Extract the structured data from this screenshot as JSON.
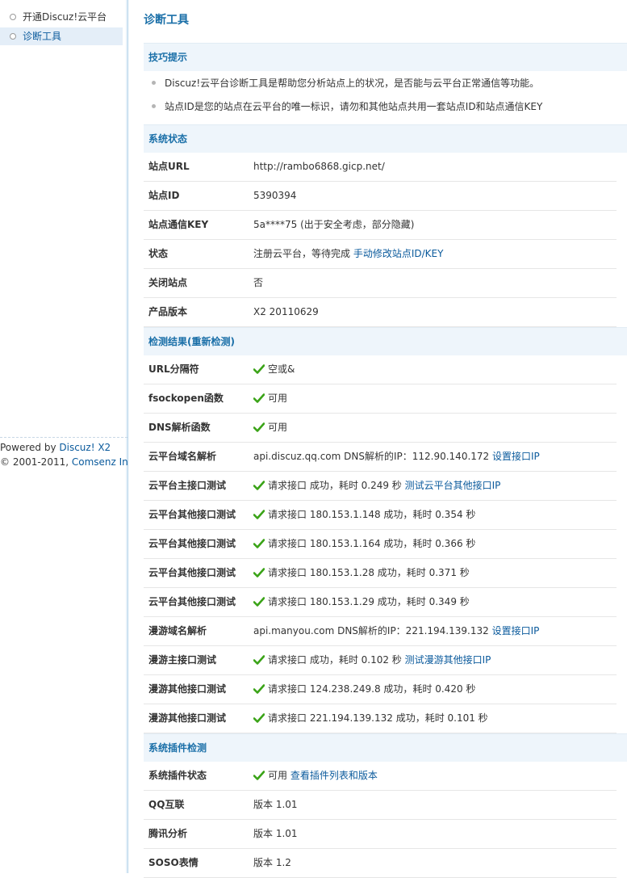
{
  "sidebar": {
    "items": [
      {
        "label": "开通Discuz!云平台"
      },
      {
        "label": "诊断工具"
      }
    ],
    "powered_prefix": "Powered by ",
    "powered_link": "Discuz! X2",
    "copyright_prefix": "© 2001-2011, ",
    "copyright_link": "Comsenz Inc."
  },
  "page_title": "诊断工具",
  "tips": {
    "header": "技巧提示",
    "items": [
      "Discuz!云平台诊断工具是帮助您分析站点上的状况，是否能与云平台正常通信等功能。",
      "站点ID是您的站点在云平台的唯一标识，请勿和其他站点共用一套站点ID和站点通信KEY"
    ]
  },
  "system_status": {
    "header": "系统状态",
    "rows": [
      {
        "label": "站点URL",
        "value": "http://rambo6868.gicp.net/"
      },
      {
        "label": "站点ID",
        "value": "5390394"
      },
      {
        "label": "站点通信KEY",
        "value": "5a****75 (出于安全考虑，部分隐藏)"
      },
      {
        "label": "状态",
        "value": "注册云平台，等待完成 ",
        "link": "手动修改站点ID/KEY"
      },
      {
        "label": "关闭站点",
        "value": "否"
      },
      {
        "label": "产品版本",
        "value": "X2 20110629"
      }
    ]
  },
  "detection": {
    "header": "检测结果(重新检测)",
    "rows": [
      {
        "label": "URL分隔符",
        "check": true,
        "value": "空或&"
      },
      {
        "label": "fsockopen函数",
        "check": true,
        "value": "可用"
      },
      {
        "label": "DNS解析函数",
        "check": true,
        "value": "可用"
      },
      {
        "label": "云平台域名解析",
        "check": false,
        "value": "api.discuz.qq.com DNS解析的IP：112.90.140.172 ",
        "link": "设置接口IP"
      },
      {
        "label": "云平台主接口测试",
        "check": true,
        "value": "请求接口 成功，耗时 0.249 秒 ",
        "link": "测试云平台其他接口IP"
      },
      {
        "label": "云平台其他接口测试",
        "check": true,
        "value": "请求接口 180.153.1.148 成功，耗时 0.354 秒"
      },
      {
        "label": "云平台其他接口测试",
        "check": true,
        "value": "请求接口 180.153.1.164 成功，耗时 0.366 秒"
      },
      {
        "label": "云平台其他接口测试",
        "check": true,
        "value": "请求接口 180.153.1.28 成功，耗时 0.371 秒"
      },
      {
        "label": "云平台其他接口测试",
        "check": true,
        "value": "请求接口 180.153.1.29 成功，耗时 0.349 秒"
      },
      {
        "label": "漫游域名解析",
        "check": false,
        "value": "api.manyou.com DNS解析的IP：221.194.139.132 ",
        "link": "设置接口IP"
      },
      {
        "label": "漫游主接口测试",
        "check": true,
        "value": "请求接口 成功，耗时 0.102 秒 ",
        "link": "测试漫游其他接口IP"
      },
      {
        "label": "漫游其他接口测试",
        "check": true,
        "value": "请求接口 124.238.249.8 成功，耗时 0.420 秒"
      },
      {
        "label": "漫游其他接口测试",
        "check": true,
        "value": "请求接口 221.194.139.132 成功，耗时 0.101 秒"
      }
    ]
  },
  "plugins": {
    "header": "系统插件检测",
    "rows": [
      {
        "label": "系统插件状态",
        "check": true,
        "value": "可用 ",
        "link": "查看插件列表和版本"
      },
      {
        "label": "QQ互联",
        "check": false,
        "value": "版本 1.01"
      },
      {
        "label": "腾讯分析",
        "check": false,
        "value": "版本 1.01"
      },
      {
        "label": "SOSO表情",
        "check": false,
        "value": "版本 1.2"
      }
    ]
  },
  "colors": {
    "accent": "#1a6fa8",
    "link": "#0a5a9c",
    "section_bg": "#eef5fb",
    "check_green": "#3aa317"
  },
  "icons": {
    "check": "check-icon",
    "bullet": "circle-bullet-icon"
  }
}
